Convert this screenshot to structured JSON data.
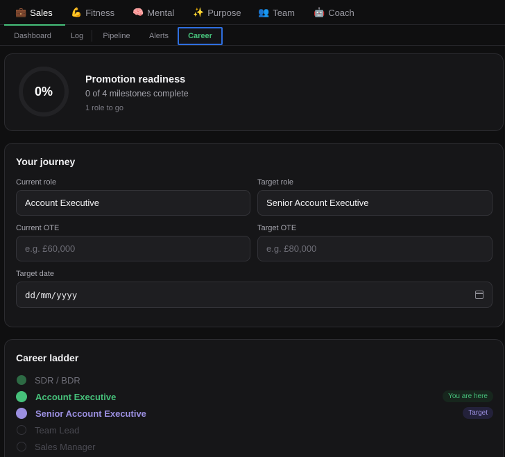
{
  "nav": {
    "top_tabs": [
      {
        "emoji": "💼",
        "label": "Sales",
        "active": true
      },
      {
        "emoji": "💪",
        "label": "Fitness"
      },
      {
        "emoji": "🧠",
        "label": "Mental"
      },
      {
        "emoji": "✨",
        "label": "Purpose"
      },
      {
        "emoji": "👥",
        "label": "Team"
      },
      {
        "emoji": "🤖",
        "label": "Coach"
      }
    ],
    "sub_tabs": [
      "Dashboard",
      "Log",
      "Pipeline",
      "Alerts",
      "Career"
    ],
    "active_sub_tab": "Career"
  },
  "readiness": {
    "percent": "0%",
    "title": "Promotion readiness",
    "subtitle": "0 of 4 milestones complete",
    "note": "1 role to go"
  },
  "journey": {
    "title": "Your journey",
    "current_role_label": "Current role",
    "current_role_value": "Account Executive",
    "target_role_label": "Target role",
    "target_role_value": "Senior Account Executive",
    "current_ote_label": "Current OTE",
    "current_ote_placeholder": "e.g. £60,000",
    "target_ote_label": "Target OTE",
    "target_ote_placeholder": "e.g. £80,000",
    "target_date_label": "Target date",
    "target_date_placeholder": "dd/mm/yyyy"
  },
  "ladder": {
    "title": "Career ladder",
    "steps": [
      {
        "label": "SDR / BDR",
        "state": "done",
        "badge": ""
      },
      {
        "label": "Account Executive",
        "state": "current",
        "badge": "You are here"
      },
      {
        "label": "Senior Account Executive",
        "state": "target",
        "badge": "Target"
      },
      {
        "label": "Team Lead",
        "state": "future",
        "badge": ""
      },
      {
        "label": "Sales Manager",
        "state": "future",
        "badge": ""
      }
    ]
  },
  "colors": {
    "accent_green": "#46c07a",
    "accent_purple": "#9b8fe0",
    "done_green": "#2d6a44",
    "focus_blue": "#2f6fe0"
  }
}
